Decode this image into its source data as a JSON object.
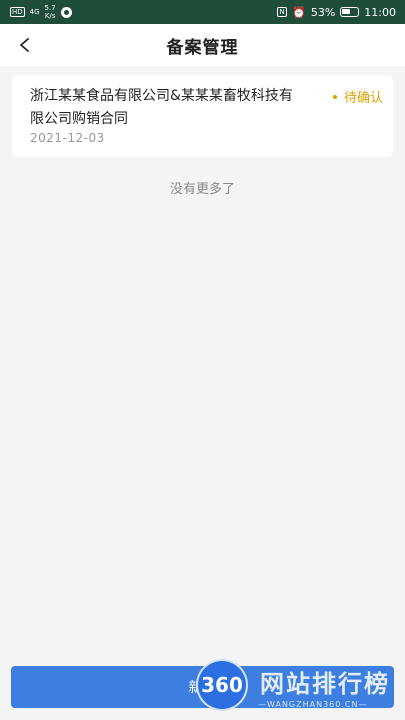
{
  "status_bar": {
    "hd_label": "HD",
    "network_type": "4G",
    "net_speed": "5.7",
    "net_speed_unit": "K/s",
    "battery": "53%",
    "time": "11:00"
  },
  "header": {
    "title": "备案管理",
    "back_icon": "chevron-left-icon"
  },
  "records": [
    {
      "title": "浙江某某食品有限公司&某某某畜牧科技有限公司购销合同",
      "date": "2021-12-03",
      "status": "待确认",
      "status_color": "#e0a000"
    }
  ],
  "list_footer": "没有更多了",
  "footer": {
    "add_label": "新增"
  },
  "watermark": {
    "logo_text": "360",
    "title": "网站排行榜",
    "subtitle": "—WANGZHAN360.CN—"
  },
  "colors": {
    "status_bar_bg": "#1e4d3a",
    "primary": "#3d7fe0",
    "background": "#f4f4f4"
  }
}
